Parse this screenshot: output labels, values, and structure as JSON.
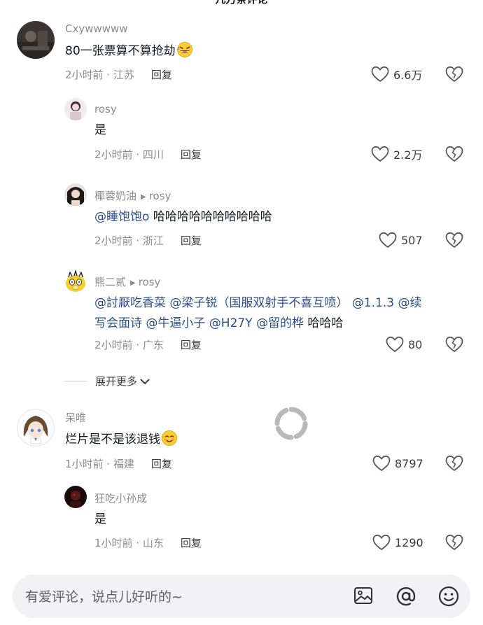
{
  "header": {
    "title": "几万条评论"
  },
  "comments": [
    {
      "username": "Cxywwwww",
      "text": "80一张票算不算抢劫",
      "meta": "2小时前 · 江苏",
      "reply": "回复",
      "likes": "6.6万"
    },
    {
      "username": "rosy",
      "text": "是",
      "meta": "2小时前 · 四川",
      "reply": "回复",
      "likes": "2.2万"
    },
    {
      "username": "椰蓉奶油",
      "reply_to": "rosy",
      "mention": "@睡饱饱o",
      "text": " 哈哈哈哈哈哈哈哈哈哈",
      "meta": "2小时前 · 浙江",
      "reply": "回复",
      "likes": "507"
    },
    {
      "username": "熊二贰",
      "reply_to": "rosy",
      "line1_mention": "@討厭吃香菜 @梁子锐（国服双射手不喜互喷） @1.1.3 @续",
      "line2_mention": "写会面诗 @牛逼小子 @H27Y @留的桦",
      "line2_text": " 哈哈哈",
      "meta": "2小时前 · 广东",
      "reply": "回复",
      "likes": "80"
    },
    {
      "username": "呆唯",
      "text": "烂片是不是该退钱",
      "meta": "1小时前 · 福建",
      "reply": "回复",
      "likes": "8797"
    },
    {
      "username": "狂吃小孙成",
      "text": "是",
      "meta": "1小时前 · 山东",
      "reply": "回复",
      "likes": "1290"
    }
  ],
  "expand_label": "展开更多",
  "input": {
    "placeholder": "有爱评论，说点儿好听的~"
  },
  "icons": {
    "like": "heart-outline-icon",
    "dislike": "broken-heart-icon",
    "image": "image-icon",
    "mention": "at-icon",
    "emoji": "smiley-icon",
    "loading": "spinner-icon"
  }
}
